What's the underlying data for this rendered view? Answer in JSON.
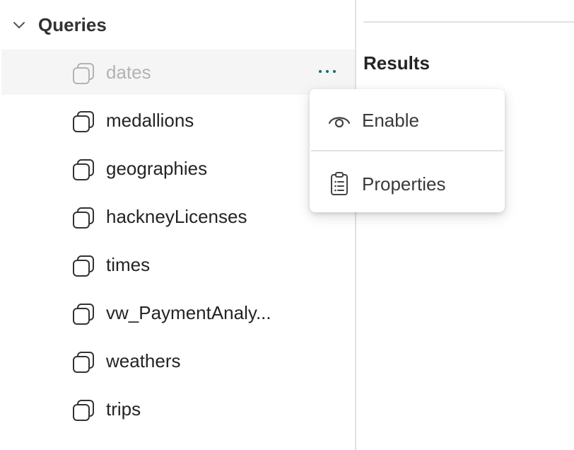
{
  "sidebar": {
    "section_title": "Queries",
    "items": [
      {
        "label": "dates",
        "disabled": true
      },
      {
        "label": "medallions"
      },
      {
        "label": "geographies"
      },
      {
        "label": "hackneyLicenses"
      },
      {
        "label": "times"
      },
      {
        "label": "vw_PaymentAnaly..."
      },
      {
        "label": "weathers"
      },
      {
        "label": "trips"
      }
    ]
  },
  "results": {
    "title": "Results"
  },
  "context_menu": {
    "items": [
      {
        "label": "Enable",
        "icon": "eye-icon"
      },
      {
        "label": "Properties",
        "icon": "clipboard-list-icon"
      }
    ]
  },
  "colors": {
    "accent": "#0f6e66",
    "selected_row_bg": "#f5f5f5",
    "disabled_text": "#b3b3b3",
    "text": "#242424",
    "border": "#e1e1e1"
  }
}
